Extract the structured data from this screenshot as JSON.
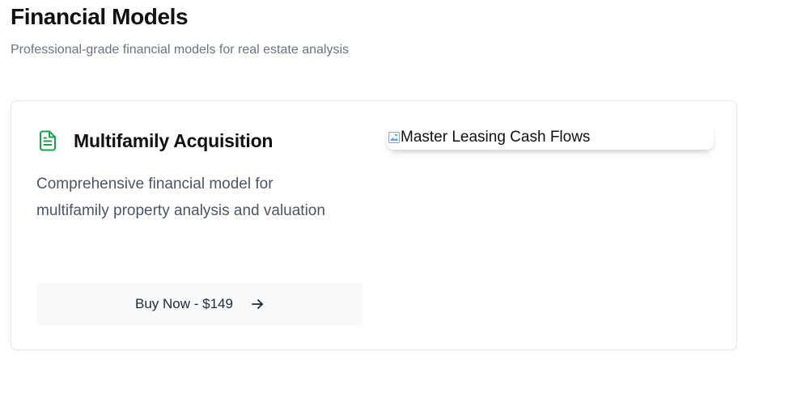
{
  "header": {
    "title": "Financial Models",
    "subtitle": "Professional-grade financial models for real estate analysis"
  },
  "product": {
    "icon": "document-text-icon",
    "title": "Multifamily Acquisition",
    "description": "Comprehensive financial model for multifamily property analysis and valuation",
    "buy_button_label": "Buy Now - $149",
    "buy_button_icon": "arrow-right-icon",
    "image_alt": "Master Leasing Cash Flows"
  },
  "colors": {
    "accent_icon": "#16a34a",
    "button_bg": "#f8f9fb",
    "text_muted": "#6b7280",
    "card_border": "#e5e7eb"
  }
}
